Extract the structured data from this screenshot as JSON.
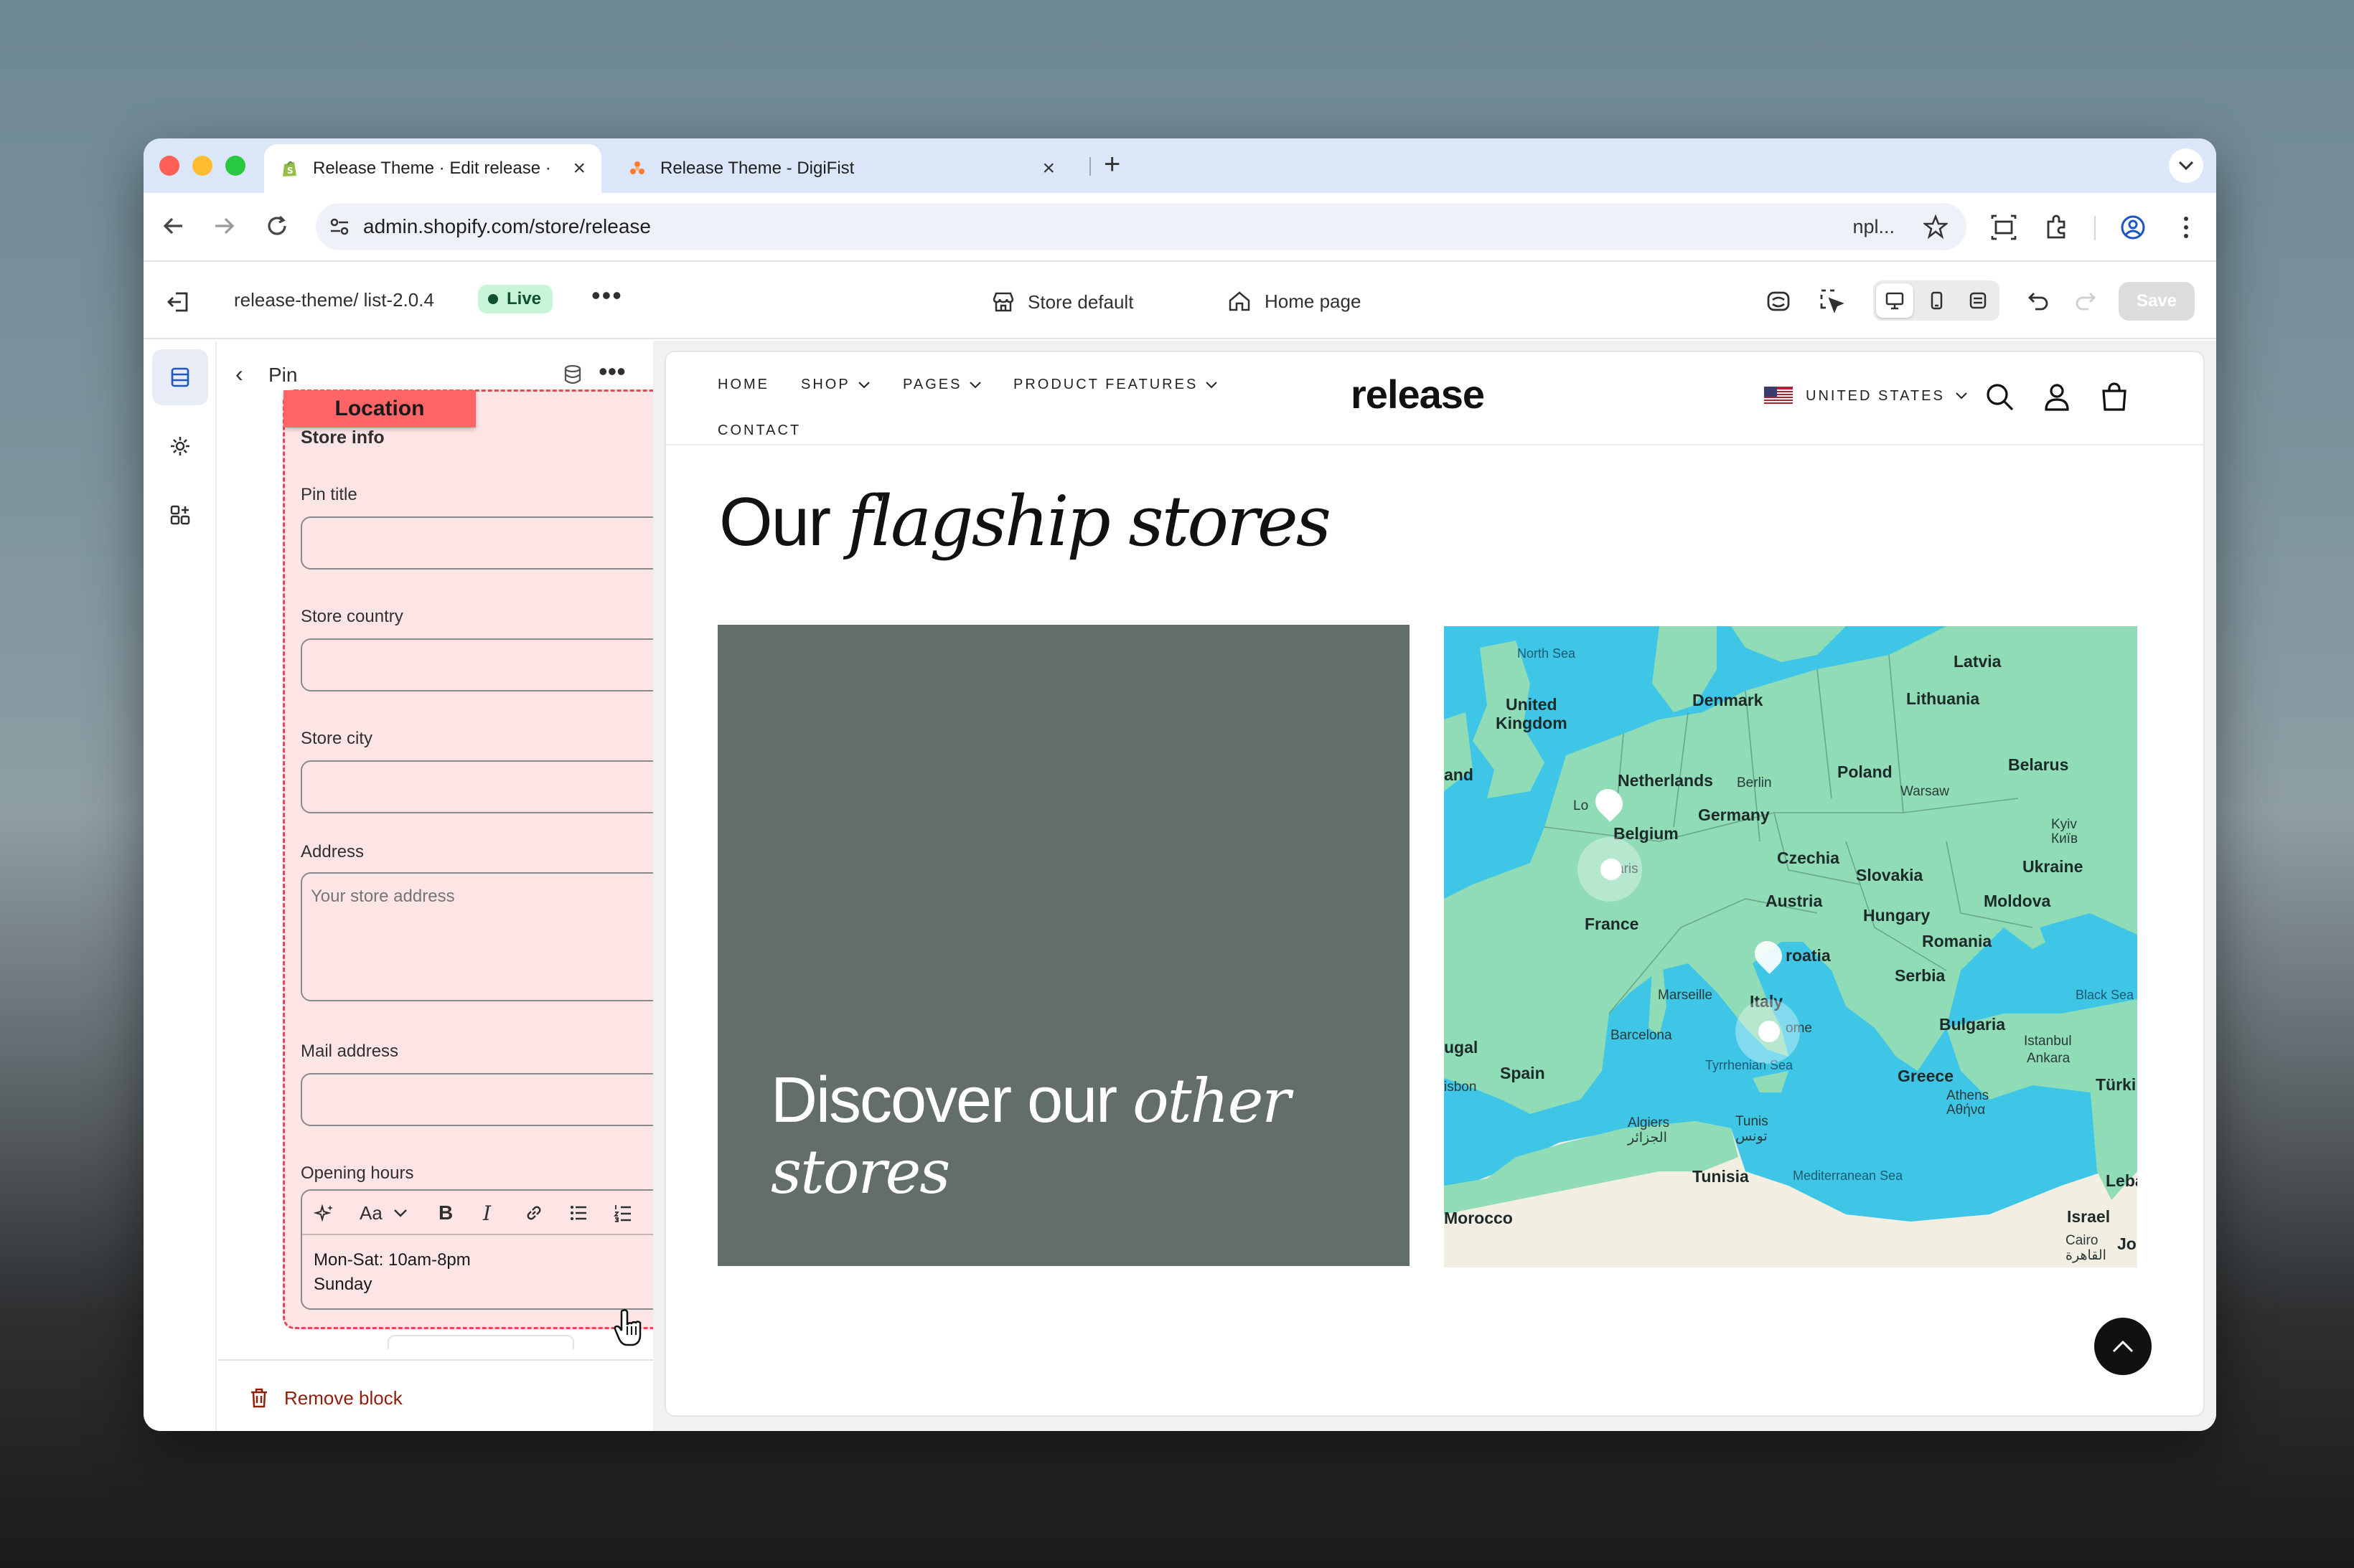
{
  "browser": {
    "tabs": [
      {
        "title": "Release Theme · Edit release ·",
        "active": true,
        "close": "×"
      },
      {
        "title": "Release Theme - DigiFist",
        "active": false,
        "close": "×"
      }
    ],
    "new_tab": "+",
    "url": "admin.shopify.com/store/release",
    "extension_text": "npl..."
  },
  "editor": {
    "theme_name": "release-theme/ list-2.0.4",
    "live_label": "Live",
    "more": "•••",
    "store_selector": "Store default",
    "page_selector": "Home page",
    "save_label": "Save"
  },
  "sidebar": {
    "back": "‹",
    "title": "Pin",
    "more": "•••",
    "location_tag": "Location",
    "section_heading": "Store info",
    "fields": {
      "pin_title": {
        "label": "Pin title",
        "value": ""
      },
      "store_country": {
        "label": "Store country",
        "value": ""
      },
      "store_city": {
        "label": "Store city",
        "value": ""
      },
      "address": {
        "label": "Address",
        "placeholder": "Your store address"
      },
      "mail_address": {
        "label": "Mail address",
        "value": ""
      },
      "opening_hours": {
        "label": "Opening hours",
        "lines": [
          "Mon-Sat: 10am-8pm",
          "Sunday"
        ]
      }
    },
    "richtext_toolbar": {
      "font": "Aa",
      "bold": "B",
      "italic": "I"
    },
    "remove_block": "Remove block"
  },
  "storefront": {
    "nav": [
      {
        "label": "HOME",
        "dropdown": false
      },
      {
        "label": "SHOP",
        "dropdown": true
      },
      {
        "label": "PAGES",
        "dropdown": true
      },
      {
        "label": "PRODUCT FEATURES",
        "dropdown": true
      },
      {
        "label": "CONTACT",
        "dropdown": false
      }
    ],
    "logo": "release",
    "locale": "UNITED STATES",
    "heading_plain": "Our ",
    "heading_italic": "flagship stores",
    "promo_plain": "Discover our ",
    "promo_italic_1": "other",
    "promo_italic_2": "stores",
    "map_labels": {
      "countries": [
        "Latvia",
        "United",
        "Kingdom",
        "Denmark",
        "Lithuania",
        "Netherlands",
        "Poland",
        "Belarus",
        "Germany",
        "Belgium",
        "Czechia",
        "Slovakia",
        "Ukraine",
        "Austria",
        "Moldova",
        "Hungary",
        "France",
        "Romania",
        "roatia",
        "Serbia",
        "Italy",
        "Bulgaria",
        "Spain",
        "Greece",
        "Türki",
        "Tunisia",
        "Morocco",
        "Israel",
        "Leba",
        "and",
        "ugal"
      ],
      "cities": [
        "Berlin",
        "Warsaw",
        "Kyiv",
        "Київ",
        "Lo",
        "n",
        "aris",
        "Marseille",
        "Barcelona",
        "ome",
        "Istanbul",
        "Ankara",
        "Athens",
        "Αθήνα",
        "Algiers",
        "الجزائر",
        "Tunis",
        "تونس",
        "Cairo",
        "القاهرة",
        "isbon",
        "Jo"
      ],
      "seas": [
        "North Sea",
        "Black Sea",
        "Tyrrhenian Sea",
        "Mediterranean Sea"
      ]
    }
  },
  "colors": {
    "live_bg": "#c8f5d7",
    "location_border": "#e54954",
    "location_tag": "#ff6467",
    "promo_bg": "#636e6a",
    "map_sea": "#3fc6e6",
    "map_land": "#8fdcb6",
    "remove_text": "#8e1f0b"
  }
}
